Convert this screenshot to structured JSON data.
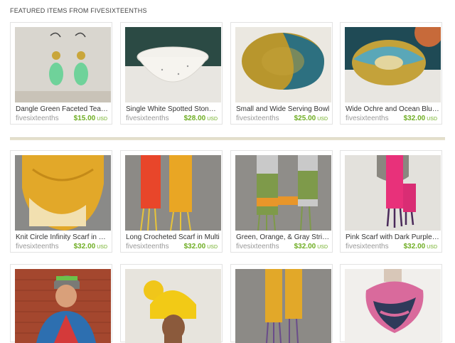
{
  "section": {
    "title": "FEATURED ITEMS FROM FIVESIXTEENTHS"
  },
  "rows": [
    [
      {
        "title": "Dangle Green Faceted Tear Drop Earrings",
        "shop": "fivesixteenths",
        "price": "$15.00",
        "currency": "USD",
        "image": "earrings"
      },
      {
        "title": "Single White Spotted Stoneware Bowl",
        "shop": "fivesixteenths",
        "price": "$28.00",
        "currency": "USD",
        "image": "white-bowl"
      },
      {
        "title": "Small and Wide Serving Bowl",
        "shop": "fivesixteenths",
        "price": "$25.00",
        "currency": "USD",
        "image": "ochre-blue-bowl"
      },
      {
        "title": "Wide Ochre and Ocean Blue Bowl",
        "shop": "fivesixteenths",
        "price": "$32.00",
        "currency": "USD",
        "image": "ochre-ocean-bowl"
      }
    ],
    [
      {
        "title": "Knit Circle Infinity Scarf in Butter",
        "shop": "fivesixteenths",
        "price": "$32.00",
        "currency": "USD",
        "image": "yellow-infinity-scarf"
      },
      {
        "title": "Long Crocheted Scarf in Multi",
        "shop": "fivesixteenths",
        "price": "$32.00",
        "currency": "USD",
        "image": "orange-yellow-scarf"
      },
      {
        "title": "Green, Orange, & Gray Striped Scarf",
        "shop": "fivesixteenths",
        "price": "$32.00",
        "currency": "USD",
        "image": "green-orange-gray-scarf"
      },
      {
        "title": "Pink Scarf with Dark Purple Fringe",
        "shop": "fivesixteenths",
        "price": "$32.00",
        "currency": "USD",
        "image": "pink-scarf"
      }
    ],
    [
      {
        "title": "",
        "shop": "",
        "price": "",
        "currency": "",
        "image": "man-beanie"
      },
      {
        "title": "",
        "shop": "",
        "price": "",
        "currency": "",
        "image": "yellow-hat"
      },
      {
        "title": "",
        "shop": "",
        "price": "",
        "currency": "",
        "image": "yellow-long-scarf"
      },
      {
        "title": "",
        "shop": "",
        "price": "",
        "currency": "",
        "image": "pink-navy-cowl"
      }
    ]
  ]
}
